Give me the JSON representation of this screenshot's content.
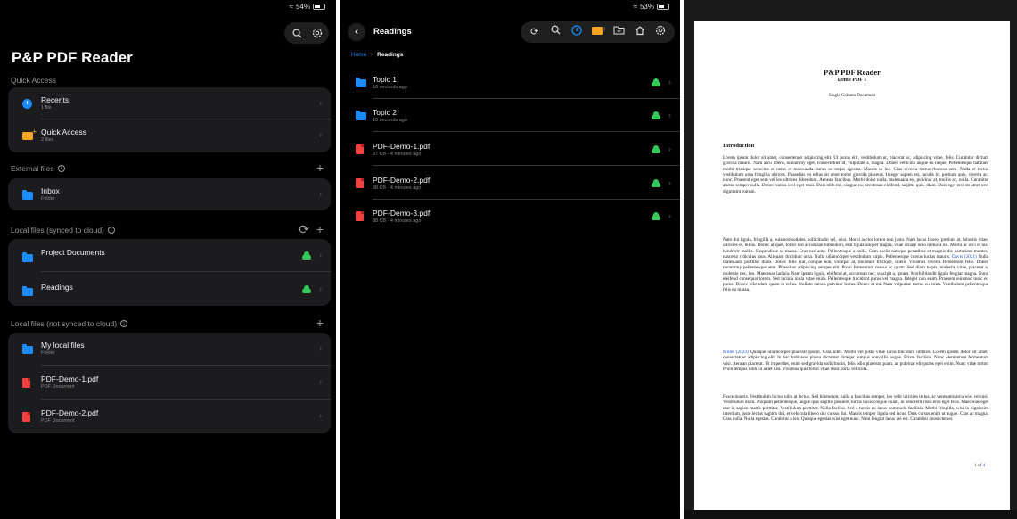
{
  "panel1": {
    "status": {
      "battery": "54%"
    },
    "app_title": "P&P PDF Reader",
    "quick_access": {
      "title": "Quick Access",
      "items": [
        {
          "label": "Recents",
          "sub": "1 file"
        },
        {
          "label": "Quick Access",
          "sub": "2 files"
        }
      ]
    },
    "external": {
      "title": "External files",
      "items": [
        {
          "label": "Inbox",
          "sub": "Folder"
        }
      ]
    },
    "local_synced": {
      "title": "Local files (synced to cloud)",
      "items": [
        {
          "label": "Project Documents",
          "sub": ""
        },
        {
          "label": "Readings",
          "sub": ""
        }
      ]
    },
    "local_unsynced": {
      "title": "Local files (not synced to cloud)",
      "items": [
        {
          "label": "My local files",
          "sub": "Folder"
        },
        {
          "label": "PDF-Demo-1.pdf",
          "sub": "PDF Document"
        },
        {
          "label": "PDF-Demo-2.pdf",
          "sub": "PDF Document"
        }
      ]
    }
  },
  "panel2": {
    "status": {
      "battery": "53%"
    },
    "title": "Readings",
    "breadcrumb": {
      "home": "Home",
      "current": "Readings"
    },
    "items": [
      {
        "label": "Topic 1",
        "sub": "10 seconds ago",
        "kind": "folder"
      },
      {
        "label": "Topic 2",
        "sub": "10 seconds ago",
        "kind": "folder"
      },
      {
        "label": "PDF-Demo-1.pdf",
        "sub": "87 KB · 4 minutes ago",
        "kind": "pdf"
      },
      {
        "label": "PDF-Demo-2.pdf",
        "sub": "88 KB · 4 minutes ago",
        "kind": "pdf"
      },
      {
        "label": "PDF-Demo-3.pdf",
        "sub": "88 KB · 4 minutes ago",
        "kind": "pdf"
      }
    ]
  },
  "panel3": {
    "doc_title": "P&P PDF Reader",
    "doc_subtitle": "Demo PDF 1",
    "doc_kind": "Single Column Document",
    "heading": "Introduction",
    "para1": "Lorem ipsum dolor sit amet, consectetuer adipiscing elit. Ut purus elit, vestibulum ut, placerat ac, adipiscing vitae, felis. Curabitur dictum gravida mauris. Nam arcu libero, nonummy eget, consectetuer id, vulputate a, magna. Donec vehicula augue eu neque. Pellentesque habitant morbi tristique senectus et netus et malesuada fames ac turpis egestas. Mauris ut leo. Cras viverra metus rhoncus sem. Nulla et lectus vestibulum urna fringilla ultrices. Phasellus eu tellus sit amet tortor gravida placerat. Integer sapien est, iaculis in, pretium quis, viverra ac, nunc. Praesent eget sem vel leo ultrices bibendum. Aenean faucibus. Morbi dolor nulla, malesuada eu, pulvinar at, mollis ac, nulla. Curabitur auctor semper nulla. Donec varius orci eget risus. Duis nibh mi, congue eu, accumsan eleifend, sagittis quis, diam. Duis eget orci sit amet orci dignissim rutrum.",
    "para2_a": "Nam dui ligula, fringilla a, euismod sodales, sollicitudin vel, wisi. Morbi auctor lorem non justo. Nam lacus libero, pretium at, lobortis vitae, ultricies et, tellus. Donec aliquet, tortor sed accumsan bibendum, erat ligula aliquet magna, vitae ornare odio metus a mi. Morbi ac orci et nisl hendrerit mollis. Suspendisse ut massa. Cras nec ante. Pellentesque a nulla. Cum sociis natoque penatibus et magnis dis parturient montes, nascetur ridiculus mus. Aliquam tincidunt urna. Nulla ullamcorper vestibulum turpis. Pellentesque cursus luctus mauris.",
    "para2_cite": "Davis (2021)",
    "para2_b": "Nulla malesuada porttitor diam. Donec felis erat, congue non, volutpat at, tincidunt tristique, libero. Vivamus viverra fermentum felis. Donec nonummy pellentesque ante. Phasellus adipiscing semper elit. Proin fermentum massa ac quam. Sed diam turpis, molestie vitae, placerat a, molestie nec, leo. Maecenas lacinia. Nam ipsum ligula, eleifend at, accumsan nec, suscipit a, ipsum. Morbi blandit ligula feugiat magna. Nunc eleifend consequat lorem. Sed lacinia nulla vitae enim. Pellentesque tincidunt purus vel magna. Integer non enim. Praesent euismod nunc eu purus. Donec bibendum quam in tellus. Nullam cursus pulvinar lectus. Donec et mi. Nam vulputate metus eu enim. Vestibulum pellentesque felis eu massa.",
    "para3_cite": "Miller (2023)",
    "para3": "Quisque ullamcorper placerat ipsum. Cras nibh. Morbi vel justo vitae lacus tincidunt ultrices. Lorem ipsum dolor sit amet, consectetuer adipiscing elit. In hac habitasse platea dictumst. Integer tempus convallis augue. Etiam facilisis. Nunc elementum fermentum wisi. Aenean placerat. Ut imperdiet, enim sed gravida sollicitudin, felis odio placerat quam, ac pulvinar elit purus eget enim. Nunc vitae tortor. Proin tempus nibh sit amet nisl. Vivamus quis tortor vitae risus porta vehicula.",
    "para4": "Fusce mauris. Vestibulum luctus nibh at lectus. Sed bibendum, nulla a faucibus semper, leo velit ultricies tellus, ac venenatis arcu wisi vel nisl. Vestibulum diam. Aliquam pellentesque, augue quis sagittis posuere, turpis lacus congue quam, in hendrerit risus eros eget felis. Maecenas eget erat in sapien mattis porttitor. Vestibulum porttitor. Nulla facilisi. Sed a turpis eu lacus commodo facilisis. Morbi fringilla, wisi in dignissim interdum, justo lectus sagittis dui, et vehicula libero dui cursus dui. Mauris tempor ligula sed lacus. Duis cursus enim ut augue. Cras ac magna. Cras nulla. Nulla egestas. Curabitur a leo. Quisque egestas wisi eget nunc. Nam feugiat lacus vel est. Curabitur consectetuer.",
    "page_num_prefix": "1 of",
    "page_num_total": "4"
  }
}
